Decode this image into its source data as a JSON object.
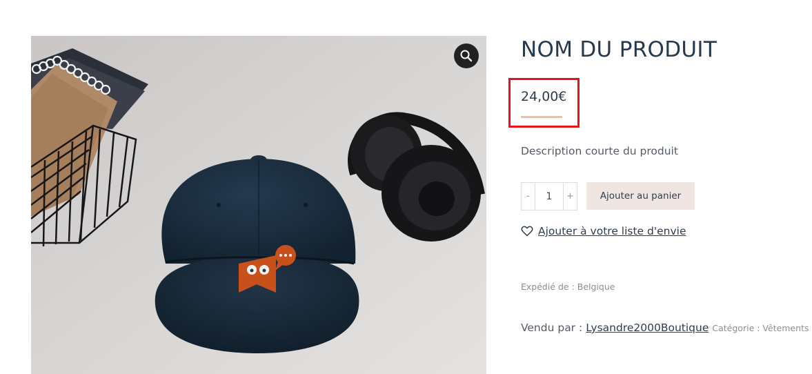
{
  "product": {
    "title": "NOM DU PRODUIT",
    "price": "24,00€",
    "short_description": "Description courte du produit"
  },
  "cart": {
    "minus_label": "-",
    "quantity": "1",
    "plus_label": "+",
    "add_to_cart_label": "Ajouter au panier"
  },
  "wishlist": {
    "label": "Ajouter à votre liste d'envie",
    "icon": "heart-icon"
  },
  "shipping": {
    "text": "Expédié de : Belgique"
  },
  "vendor": {
    "label": "Vendu par :",
    "name": "Lysandre2000Boutique",
    "category_text": "Catégorie : Vêtements •"
  },
  "gallery": {
    "zoom_icon": "magnifier-icon"
  },
  "colors": {
    "title": "#26394d",
    "price_underline": "#dcc3b4",
    "add_to_cart_bg": "#efe6e1",
    "highlight_border": "#e5141b",
    "cap": "#1c2e40",
    "logo": "#c8511b"
  }
}
